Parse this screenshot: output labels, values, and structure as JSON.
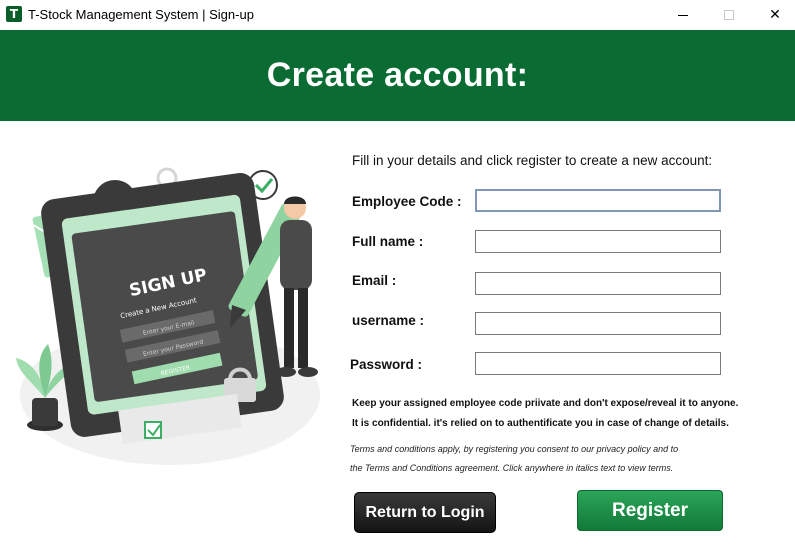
{
  "window": {
    "title": "T-Stock Management System | Sign-up",
    "app_icon_letter": "T",
    "controls": {
      "minimize_icon": "minimize-icon",
      "maximize_icon": "maximize-icon",
      "close_symbol": "✕"
    }
  },
  "banner": {
    "title": "Create account:"
  },
  "illustration": {
    "heading": "SIGN UP",
    "subheading": "Create a New Account",
    "email_placeholder": "Enter your E-mail",
    "password_placeholder": "Enter your Password",
    "button_label": "REGISTER"
  },
  "form": {
    "intro": "Fill in your details and click register to create a new account:",
    "fields": [
      {
        "label": "Employee Code :",
        "value": ""
      },
      {
        "label": "Full name :",
        "value": ""
      },
      {
        "label": "Email :",
        "value": ""
      },
      {
        "label": "username :",
        "value": ""
      },
      {
        "label": "Password :",
        "value": ""
      }
    ],
    "note_line1": "Keep your assigned employee code priivate and don't expose/reveal it to anyone.",
    "note_line2": "It is confidential. it's relied on to authentificate you in case of change of details.",
    "terms_line1": "Terms and conditions apply, by registering you consent to our privacy policy and to",
    "terms_line2": "the Terms and Conditions agreement. Click anywhere in italics text to view terms."
  },
  "buttons": {
    "login": "Return to Login",
    "register": "Register"
  },
  "colors": {
    "brand_green": "#0a6b33",
    "register_green": "#1f8f48",
    "login_dark": "#1e1e1e"
  }
}
